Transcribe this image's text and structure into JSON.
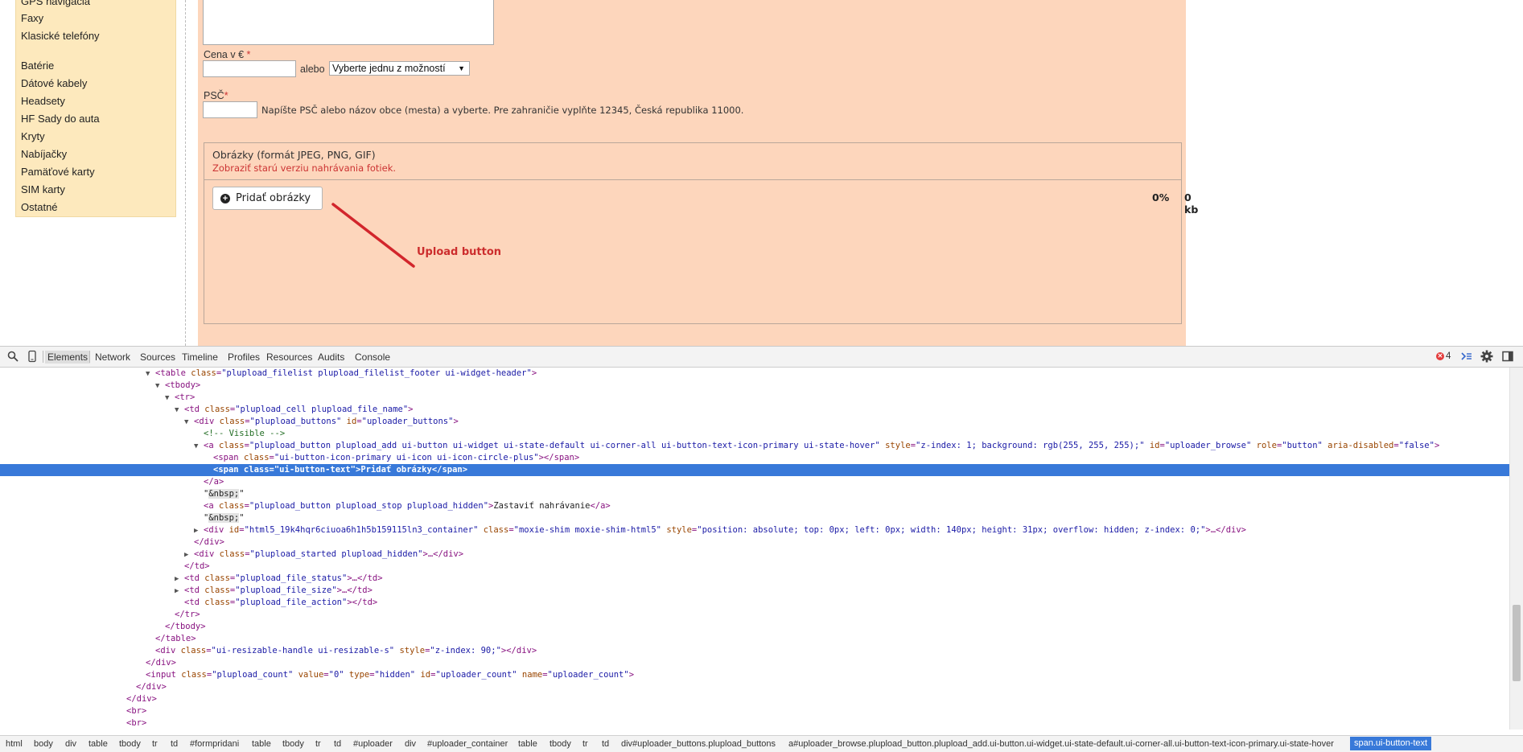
{
  "sidebar": {
    "items": [
      "GPS navigácia",
      "Faxy",
      "Klasické telefóny",
      "Batérie",
      "Dátové kabely",
      "Headsety",
      "HF Sady do auta",
      "Kryty",
      "Nabíjačky",
      "Pamäťové karty",
      "SIM karty",
      "Ostatné"
    ]
  },
  "form": {
    "price_label": "Cena v €",
    "required_mark": "*",
    "or_text": "alebo",
    "price_select": "Vyberte jednu z možností",
    "psc_label": "PSČ",
    "psc_hint": "Napíšte PSČ alebo názov obce (mesta) a vyberte. Pre zahraničie vyplňte 12345, Česká republika 11000."
  },
  "uploader": {
    "title": "Obrázky (formát JPEG, PNG, GIF)",
    "old_version_link": "Zobraziť starú verziu nahrávania fotiek.",
    "add_button": "Pridať obrázky",
    "percent": "0%",
    "size": "0 kb"
  },
  "annotation": {
    "label": "Upload button",
    "color": "#cc2d2d"
  },
  "devtools": {
    "tabs": [
      "Elements",
      "Network",
      "Sources",
      "Timeline",
      "Profiles",
      "Resources",
      "Audits",
      "Console"
    ],
    "active_tab": "Elements",
    "error_count": "4",
    "code": {
      "l1a": "<table ",
      "l1b": "class",
      "l1c": "\"plupload_filelist plupload_filelist_footer ui-widget-header\"",
      "l2": "<tbody>",
      "l3": "<tr>",
      "l4a": "<td ",
      "l4b": "class",
      "l4c": "\"plupload_cell plupload_file_name\"",
      "l5a": "<div ",
      "l5b": "class",
      "l5c": "\"plupload_buttons\"",
      "l5d": "id",
      "l5e": "\"uploader_buttons\"",
      "l6": "<!-- Visible -->",
      "l7a": "<a ",
      "l7b": "class",
      "l7c": "\"plupload_button plupload_add ui-button ui-widget ui-state-default ui-corner-all ui-button-text-icon-primary ui-state-hover\"",
      "l7d": "style",
      "l7e": "\"z-index: 1; background: rgb(255, 255, 255);\"",
      "l7f": "id",
      "l7g": "\"uploader_browse\"",
      "l7h": "role",
      "l7i": "\"button\"",
      "l7j": "aria-disabled",
      "l7k": "\"false\"",
      "l8a": "<span ",
      "l8b": "class",
      "l8c": "\"ui-button-icon-primary ui-icon ui-icon-circle-plus\"",
      "l8d": "></span>",
      "l9": "<span class=\"ui-button-text\">Pridať obrázky</span>",
      "l10": "</a>",
      "l11": "&nbsp;",
      "l12a": "<a ",
      "l12b": "class",
      "l12c": "\"plupload_button plupload_stop plupload_hidden\"",
      "l12d": "Zastaviť nahrávanie",
      "l12e": "</a>",
      "l13": "&nbsp;",
      "l14a": "<div ",
      "l14b": "id",
      "l14c": "\"html5_19k4hqr6ciuoa6h1h5b159115ln3_container\"",
      "l14d": "class",
      "l14e": "\"moxie-shim moxie-shim-html5\"",
      "l14f": "style",
      "l14g": "\"position: absolute; top: 0px; left: 0px; width: 140px; height: 31px; overflow: hidden; z-index: 0;\"",
      "l14h": "…</div>",
      "l15": "</div>",
      "l16a": "<div ",
      "l16b": "class",
      "l16c": "\"plupload_started plupload_hidden\"",
      "l16d": "…</div>",
      "l17": "</td>",
      "l18a": "<td ",
      "l18b": "class",
      "l18c": "\"plupload_file_status\"",
      "l18d": "…</td>",
      "l19a": "<td ",
      "l19b": "class",
      "l19c": "\"plupload_file_size\"",
      "l19d": "…</td>",
      "l20a": "<td ",
      "l20b": "class",
      "l20c": "\"plupload_file_action\"",
      "l20d": "></td>",
      "l21": "</tr>",
      "l22": "</tbody>",
      "l23": "</table>",
      "l24a": "<div ",
      "l24b": "class",
      "l24c": "\"ui-resizable-handle ui-resizable-s\"",
      "l24d": "style",
      "l24e": "\"z-index: 90;\"",
      "l24f": "></div>",
      "l25": "</div>",
      "l26a": "<input ",
      "l26b": "class",
      "l26c": "\"plupload_count\"",
      "l26d": "value",
      "l26e": "\"0\"",
      "l26f": "type",
      "l26g": "\"hidden\"",
      "l26h": "id",
      "l26i": "\"uploader_count\"",
      "l26j": "name",
      "l26k": "\"uploader_count\"",
      "l27": "</div>",
      "l28": "</div>",
      "l29": "<br>",
      "l30": "<br>"
    },
    "breadcrumb": [
      "html",
      "body",
      "div",
      "table",
      "tbody",
      "tr",
      "td",
      "#formpridani",
      "table",
      "tbody",
      "tr",
      "td",
      "#uploader",
      "div",
      "#uploader_container",
      "table",
      "tbody",
      "tr",
      "td",
      "div#uploader_buttons.plupload_buttons",
      "a#uploader_browse.plupload_button.plupload_add.ui-button.ui-widget.ui-state-default.ui-corner-all.ui-button-text-icon-primary.ui-state-hover",
      "span.ui-button-text"
    ]
  }
}
